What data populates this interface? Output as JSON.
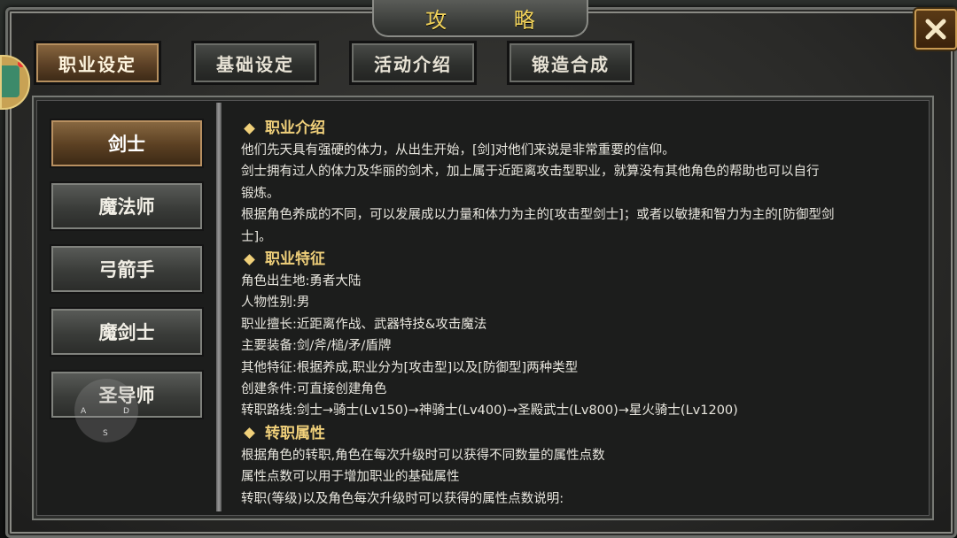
{
  "window": {
    "title": "攻 略",
    "close_label": "✕"
  },
  "tabs": [
    {
      "label": "职业设定",
      "active": true
    },
    {
      "label": "基础设定",
      "active": false
    },
    {
      "label": "活动介绍",
      "active": false
    },
    {
      "label": "锻造合成",
      "active": false
    }
  ],
  "classes": [
    {
      "label": "剑士",
      "active": true
    },
    {
      "label": "魔法师",
      "active": false
    },
    {
      "label": "弓箭手",
      "active": false
    },
    {
      "label": "魔剑士",
      "active": false
    },
    {
      "label": "圣导师",
      "active": false
    }
  ],
  "joystick": {
    "a": "A",
    "d": "D",
    "s": "S"
  },
  "sections": [
    {
      "heading": "职业介绍",
      "lines": [
        "他们先天具有强硬的体力，从出生开始，[剑]对他们来说是非常重要的信仰。",
        "剑士拥有过人的体力及华丽的剑术，加上属于近距离攻击型职业，就算没有其他角色的帮助也可以自行",
        "锻炼。",
        "根据角色养成的不同，可以发展成以力量和体力为主的[攻击型剑士]；或者以敏捷和智力为主的[防御型剑",
        "士]。"
      ]
    },
    {
      "heading": "职业特征",
      "lines": [
        "角色出生地:勇者大陆",
        "人物性别:男",
        "职业擅长:近距离作战、武器特技&攻击魔法",
        "主要装备:剑/斧/槌/矛/盾牌",
        "其他特征:根据养成,职业分为[攻击型]以及[防御型]两种类型",
        "创建条件:可直接创建角色",
        "转职路线:剑士→骑士(Lv150)→神骑士(Lv400)→圣殿武士(Lv800)→星火骑士(Lv1200)"
      ]
    },
    {
      "heading": "转职属性",
      "lines": [
        "根据角色的转职,角色在每次升级时可以获得不同数量的属性点数",
        "属性点数可以用于增加职业的基础属性",
        "转职(等级)以及角色每次升级时可以获得的属性点数说明:"
      ]
    }
  ]
}
